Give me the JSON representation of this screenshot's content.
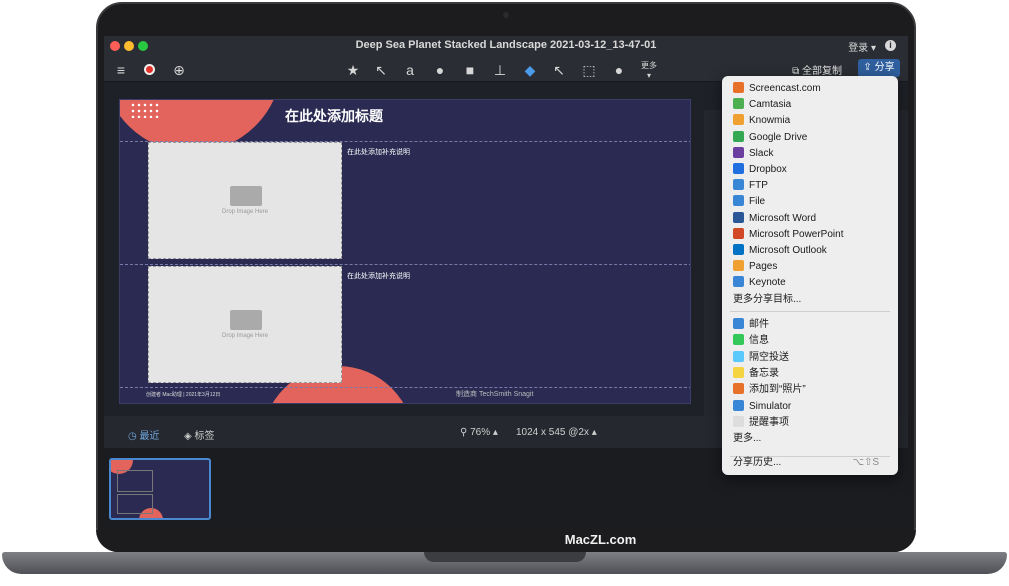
{
  "window": {
    "title": "Deep Sea Planet Stacked Landscape 2021-03-12_13-47-01",
    "login_label": "登录",
    "copy_all_label": "全部复制",
    "share_label": "分享",
    "more_label": "更多"
  },
  "document": {
    "title": "在此处添加标题",
    "caption_1": "在此处添加补充说明",
    "caption_2": "在此处添加补充说明",
    "drop_1": "Drop Image Here",
    "drop_2": "Drop Image Here",
    "footer_left": "创建者 Mac助理  |  2021年3月12日",
    "footer_right": "制造商  TechSmith Snagit"
  },
  "bottombar": {
    "recent_label": "最近",
    "tags_label": "标签",
    "zoom": "76%",
    "dims": "1024 x 545 @2x"
  },
  "share_menu": {
    "items": [
      {
        "label": "Screencast.com",
        "color": "#e8712a"
      },
      {
        "label": "Camtasia",
        "color": "#4caf50"
      },
      {
        "label": "Knowmia",
        "color": "#f0a030"
      },
      {
        "label": "Google Drive",
        "color": "#34a853"
      },
      {
        "label": "Slack",
        "color": "#6b3fa0"
      },
      {
        "label": "Dropbox",
        "color": "#1f6fe0"
      },
      {
        "label": "FTP",
        "color": "#3a86d6"
      },
      {
        "label": "File",
        "color": "#3a86d6"
      },
      {
        "label": "Microsoft Word",
        "color": "#2b5797"
      },
      {
        "label": "Microsoft PowerPoint",
        "color": "#d24726"
      },
      {
        "label": "Microsoft Outlook",
        "color": "#0072c6"
      },
      {
        "label": "Pages",
        "color": "#f0a030"
      },
      {
        "label": "Keynote",
        "color": "#3a86d6"
      }
    ],
    "more_targets": "更多分享目标...",
    "system_items": [
      {
        "label": "邮件",
        "color": "#3a86d6"
      },
      {
        "label": "信息",
        "color": "#34c759"
      },
      {
        "label": "隔空投送",
        "color": "#5ac8fa"
      },
      {
        "label": "备忘录",
        "color": "#f5d442"
      },
      {
        "label": "添加到“照片”",
        "color": "#e8712a"
      },
      {
        "label": "Simulator",
        "color": "#3a86d6"
      },
      {
        "label": "提醒事项",
        "color": "#dddddd"
      }
    ],
    "more": "更多...",
    "history": "分享历史...",
    "history_shortcut": "⌥⇧S"
  },
  "brand": "MacZL.com"
}
